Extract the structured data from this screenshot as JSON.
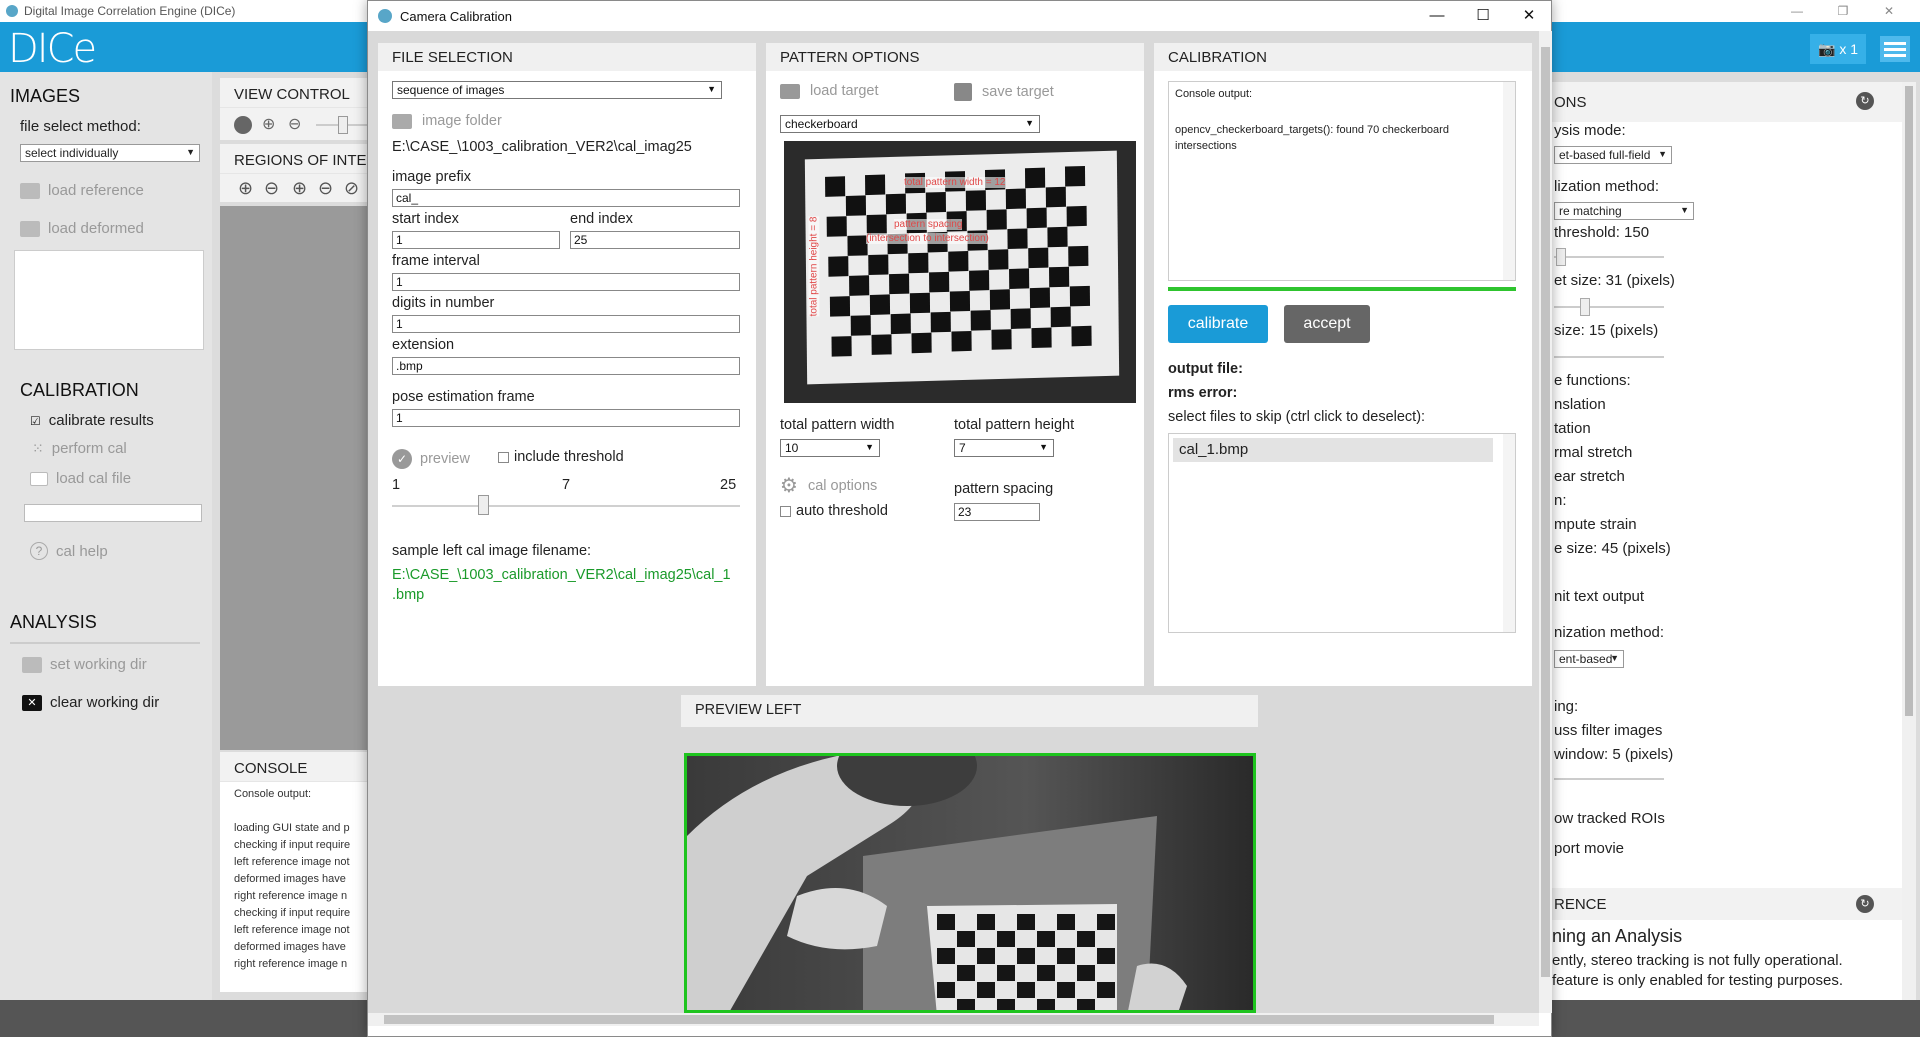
{
  "app": {
    "window_title": "Digital Image Correlation Engine (DICe)",
    "logo_text": "DICe",
    "camera_button_label": "x 1",
    "left": {
      "images_title": "IMAGES",
      "file_select_method_label": "file select method:",
      "file_select_method_value": "select individually",
      "load_reference": "load reference",
      "load_deformed": "load deformed",
      "calibration_title": "CALIBRATION",
      "calibrate_results": "calibrate results",
      "perform_cal": "perform cal",
      "load_cal_file": "load cal file",
      "cal_help": "cal help",
      "analysis_title": "ANALYSIS",
      "set_working_dir": "set working dir",
      "clear_working_dir": "clear working dir"
    },
    "middle": {
      "view_control": "VIEW CONTROL",
      "regions_of_interest": "REGIONS OF INTER",
      "console_title": "CONSOLE",
      "console_header": "Console output:",
      "console_lines": [
        "loading GUI state and p",
        "checking if input require",
        "left reference image not",
        "deformed images have",
        "right reference image n",
        "checking if input require",
        "left reference image not",
        "deformed images have",
        "right reference image n"
      ]
    },
    "right": {
      "section1_title_partial": "ONS",
      "analysis_mode_label": "ysis mode:",
      "analysis_mode_value": "et-based full-field",
      "init_method_label": "lization method:",
      "init_method_value": "re matching",
      "threshold_label": "threshold: 150",
      "subset_size_label": "et size: 31 (pixels)",
      "step_size_label": "size: 15 (pixels)",
      "shape_functions_label": "e functions:",
      "translation": "nslation",
      "rotation": "tation",
      "normal_stretch": "rmal stretch",
      "shear_stretch": "ear stretch",
      "post_label": "n:",
      "compute_strain": "mpute strain",
      "vsg_size": "e size: 45 (pixels)",
      "omit_text_output": "nit text output",
      "optimization_label": "nization method:",
      "optimization_value": "ent-based",
      "filtering_label": "ing:",
      "gauss_filter": "uss filter images",
      "gauss_window": "window: 5 (pixels)",
      "show_tracked_rois": "ow tracked ROIs",
      "export_movie": "port movie",
      "section2_title_partial": "RENCE",
      "tip_title": "ning an Analysis",
      "tip_line1": "ently, stereo tracking is not fully operational.",
      "tip_line2": "feature is only enabled for testing purposes."
    }
  },
  "dialog": {
    "title": "Camera Calibration",
    "file_selection": {
      "header": "FILE SELECTION",
      "mode_value": "sequence of images",
      "image_folder_label": "image folder",
      "folder_path": "E:\\CASE_\\1003_calibration_VER2\\cal_imag25",
      "image_prefix_label": "image prefix",
      "image_prefix_value": "cal_",
      "start_index_label": "start index",
      "start_index_value": "1",
      "end_index_label": "end index",
      "end_index_value": "25",
      "frame_interval_label": "frame interval",
      "frame_interval_value": "1",
      "digits_label": "digits in number",
      "digits_value": "1",
      "extension_label": "extension",
      "extension_value": ".bmp",
      "pose_frame_label": "pose estimation frame",
      "pose_frame_value": "1",
      "preview_label": "preview",
      "include_threshold_label": "include threshold",
      "slider_min": "1",
      "slider_mid": "7",
      "slider_max": "25",
      "sample_label": "sample left cal image filename:",
      "sample_path_line1": "E:\\CASE_\\1003_calibration_VER2\\cal_imag25\\cal_1",
      "sample_path_line2": ".bmp"
    },
    "pattern_options": {
      "header": "PATTERN OPTIONS",
      "load_target": "load target",
      "save_target": "save target",
      "target_type": "checkerboard",
      "annot_width": "total pattern width = 12",
      "annot_spacing1": "pattern spacing",
      "annot_spacing2": "(intersection to intersection)",
      "annot_height": "total pattern height = 8",
      "total_width_label": "total pattern width",
      "total_width_value": "10",
      "total_height_label": "total pattern height",
      "total_height_value": "7",
      "cal_options_label": "cal options",
      "auto_threshold_label": "auto threshold",
      "pattern_spacing_label": "pattern spacing",
      "pattern_spacing_value": "23"
    },
    "calibration": {
      "header": "CALIBRATION",
      "console_header": "Console output:",
      "console_msg": "opencv_checkerboard_targets(): found 70 checkerboard intersections",
      "calibrate_btn": "calibrate",
      "accept_btn": "accept",
      "output_file_label": "output file:",
      "rms_error_label": "rms error:",
      "skip_label": "select files to skip (ctrl click to deselect):",
      "skip_files": [
        "cal_1.bmp"
      ]
    },
    "preview_left": {
      "header": "PREVIEW LEFT"
    }
  },
  "colors": {
    "header_blue": "#1a9bd7",
    "calibrate_btn": "#1a9bd7",
    "accept_btn": "#666666",
    "progress_green": "#2ec42e",
    "path_green": "#1a9a2a"
  }
}
